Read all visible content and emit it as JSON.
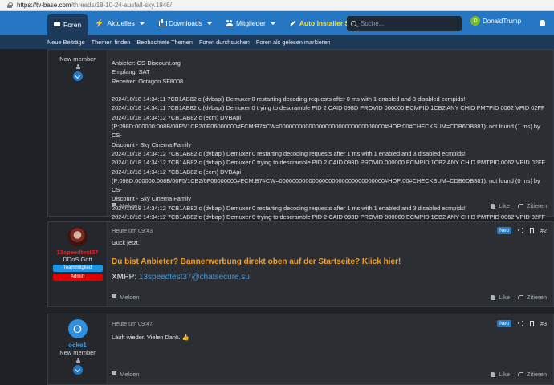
{
  "browser": {
    "url_domain": "https://tv-base.com",
    "url_path": "/threads/18-10-24-ausfall-sky.1946/"
  },
  "nav": {
    "tabs": [
      {
        "label": "Foren",
        "icon": "chat-icon",
        "active": true
      },
      {
        "label": "Aktuelles",
        "icon": "bolt-icon"
      },
      {
        "label": "Downloads",
        "icon": "download-icon"
      },
      {
        "label": "Mitglieder",
        "icon": "users-icon"
      },
      {
        "label": "Auto Installer Script",
        "icon": "wrench-icon"
      }
    ],
    "search_placeholder": "Suche...",
    "username": "DonaldTrump",
    "avatar_letter": "D"
  },
  "subnav": [
    "Neue Beiträge",
    "Themen finden",
    "Beobachtete Themen",
    "Foren durchsuchen",
    "Foren als gelesen markieren"
  ],
  "post1": {
    "role": "New member",
    "lines": [
      "Anbieter: CS-Discount.org",
      "Empfang: SAT",
      "Receiver: Octagon SF8008",
      "",
      "2024/10/18 14:34:11 7CB1AB82 c (dvbapi) Demuxer 0 restarting decoding requests after 0 ms with 1 enabled and 3 disabled ecmpids!",
      "2024/10/18 14:34:11 7CB1AB82 c (dvbapi) Demuxer 0 trying to descramble PID 2 CAID 098D PROVID 000000 ECMPID 1CB2 ANY CHID PMTPID 0062 VPID 02FF",
      "2024/10/18 14:34:12 7CB1AB82 c (ecm) DVBApi",
      "(P:098D:000000:008B/00F5/1CB2/0F06000000#ECM:B7#CW=00000000000000000000000000000000#HOP:00#CHECKSUM=CDB6DB881): not found (1 ms) by CS-",
      "Discount - Sky Cinema Family",
      "2024/10/18 14:34:12 7CB1AB82 c (dvbapi) Demuxer 0 restarting decoding requests after 1 ms with 1 enabled and 3 disabled ecmpids!",
      "2024/10/18 14:34:12 7CB1AB82 c (dvbapi) Demuxer 0 trying to descramble PID 2 CAID 098D PROVID 000000 ECMPID 1CB2 ANY CHID PMTPID 0062 VPID 02FF",
      "2024/10/18 14:34:12 7CB1AB82 c (ecm) DVBApi",
      "(P:098D:000000:008B/00F5/1CB2/0F06000000#ECM:B7#CW=00000000000000000000000000000000#HOP:00#CHECKSUM=CDB6DB881): not found (0 ms) by CS-",
      "Discount - Sky Cinema Family",
      "2024/10/18 14:34:12 7CB1AB82 c (dvbapi) Demuxer 0 restarting decoding requests after 1 ms with 1 enabled and 3 disabled ecmpids!",
      "2024/10/18 14:34:12 7CB1AB82 c (dvbapi) Demuxer 0 trying to descramble PID 2 CAID 098D PROVID 000000 ECMPID 1CB2 ANY CHID PMTPID 0062 VPID 02FF"
    ],
    "report": "Melden",
    "like": "Like",
    "quote": "Zitieren"
  },
  "post2": {
    "username": "13speedtest37",
    "title": "DDoS Gott",
    "banner1": "Teammitglied",
    "banner2": "Admin",
    "time": "Heute um 09:43",
    "badge": "Neu",
    "number": "#2",
    "text": "Guck jetzt.",
    "promo": "Du bist Anbieter? Bannerwerbung direkt oben auf der Startseite? Klick hier!",
    "xmpp_label": "XMPP: ",
    "xmpp_link": "13speedtest37@chatsecure.su",
    "report": "Melden",
    "like": "Like",
    "quote": "Zitieren"
  },
  "post3": {
    "username": "ocke1",
    "avatar_letter": "O",
    "role": "New member",
    "time": "Heute um 09:47",
    "badge": "Neu",
    "number": "#3",
    "text": "Läuft wieder. Vielen Dank. 👍",
    "report": "Melden",
    "like": "Like",
    "quote": "Zitieren"
  }
}
